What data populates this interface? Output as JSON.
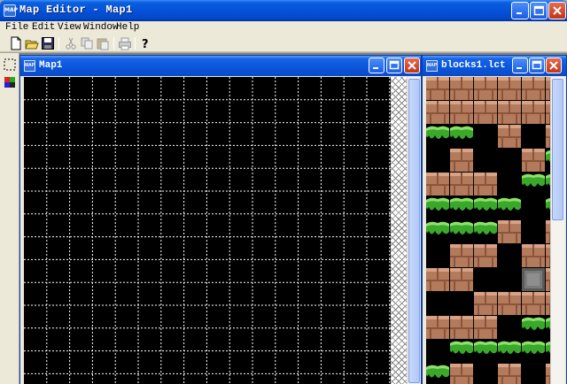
{
  "app": {
    "title": "Map Editor - Map1",
    "icon_label": "MAP"
  },
  "menu": {
    "items": [
      "File",
      "Edit",
      "View",
      "Window",
      "Help"
    ]
  },
  "toolbar": {
    "buttons": [
      "new-icon",
      "open-icon",
      "save-icon",
      "cut-icon",
      "copy-icon",
      "paste-icon",
      "print-icon",
      "help-icon"
    ]
  },
  "map_window": {
    "title": "Map1",
    "icon_label": "MAP"
  },
  "tileset_window": {
    "title": "blocks1.lct",
    "icon_label": "MAP",
    "tiles": [
      [
        "dirt",
        "dirt",
        "dirt",
        "dirt",
        "dirt",
        "dirt"
      ],
      [
        "dirt",
        "dirt",
        "dirt",
        "dirt",
        "dirt",
        "dirt"
      ],
      [
        "grass",
        "grass",
        "black",
        "dirt",
        "black",
        "dirt"
      ],
      [
        "black",
        "dirt",
        "black",
        "black",
        "dirt",
        "grass"
      ],
      [
        "dirt",
        "dirt",
        "dirt",
        "black",
        "grass",
        "grass"
      ],
      [
        "grass",
        "grass",
        "grass",
        "grass",
        "black",
        "grass"
      ],
      [
        "grass",
        "grass",
        "grass",
        "dirt",
        "black",
        "dirt"
      ],
      [
        "black",
        "dirt",
        "dirt",
        "black",
        "dirt",
        "dirt"
      ],
      [
        "dirt",
        "dirt",
        "black",
        "black",
        "stone",
        "dirt"
      ],
      [
        "black",
        "black",
        "dirt",
        "dirt",
        "dirt",
        "dirt"
      ],
      [
        "dirt",
        "dirt",
        "dirt",
        "black",
        "grass",
        "grass"
      ],
      [
        "black",
        "grass",
        "grass",
        "grass",
        "grass",
        "grass"
      ],
      [
        "grass",
        "dirt",
        "black",
        "dirt",
        "black",
        "dirt"
      ]
    ]
  },
  "colors": {
    "title_blue": "#0552d8",
    "map_background": "#000000",
    "grid_line": "#ffffff",
    "dirt": "#b47a5c",
    "grass": "#3aa82a"
  }
}
